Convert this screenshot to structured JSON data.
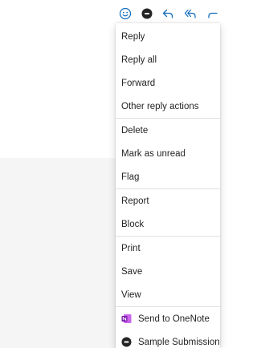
{
  "toolbar": {
    "icons": [
      "emoji-icon",
      "teams-icon",
      "reply-icon",
      "reply-all-icon",
      "forward-icon"
    ]
  },
  "menu": {
    "items": [
      {
        "label": "Reply"
      },
      {
        "label": "Reply all"
      },
      {
        "label": "Forward"
      },
      {
        "label": "Other reply actions"
      },
      {
        "label": "Delete"
      },
      {
        "label": "Mark as unread"
      },
      {
        "label": "Flag"
      },
      {
        "label": "Report"
      },
      {
        "label": "Block"
      },
      {
        "label": "Print"
      },
      {
        "label": "Save"
      },
      {
        "label": "View"
      },
      {
        "label": "Send to OneNote",
        "icon": "onenote-icon"
      },
      {
        "label": "Sample Submission",
        "icon": "addin-icon"
      }
    ]
  },
  "colors": {
    "accent": "#0f6cbd",
    "onenote": "#7719aa",
    "divider": "#e1e1e1",
    "background": "#f5f5f5"
  }
}
